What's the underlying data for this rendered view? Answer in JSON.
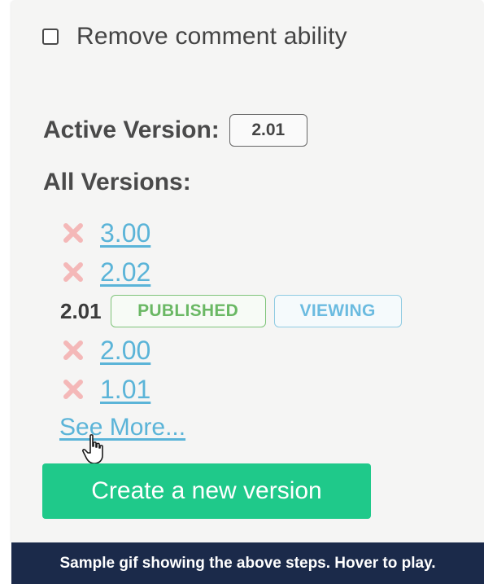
{
  "checkbox": {
    "label": "Remove comment ability",
    "checked": false
  },
  "active_version": {
    "label": "Active Version:",
    "value": "2.01"
  },
  "all_versions": {
    "label": "All Versions:",
    "items": [
      {
        "version": "3.00",
        "kind": "link",
        "deletable": true
      },
      {
        "version": "2.02",
        "kind": "link",
        "deletable": true
      },
      {
        "version": "2.01",
        "kind": "current",
        "tags": [
          "PUBLISHED",
          "VIEWING"
        ]
      },
      {
        "version": "2.00",
        "kind": "link",
        "deletable": true
      },
      {
        "version": "1.01",
        "kind": "link",
        "deletable": true
      }
    ],
    "see_more": "See More..."
  },
  "create_button": {
    "label": "Create a new version"
  },
  "caption": {
    "text": "Sample gif showing the above steps. Hover to play."
  },
  "colors": {
    "panel_bg": "#f5f5f4",
    "link": "#5bb4d8",
    "delete": "#f4b8b8",
    "published": "#6ab864",
    "viewing": "#6bbbe0",
    "button": "#1fc98a",
    "caption_bg": "#1b2a4a"
  },
  "icons": {
    "delete": "x-icon",
    "cursor": "hand-pointer-icon"
  }
}
